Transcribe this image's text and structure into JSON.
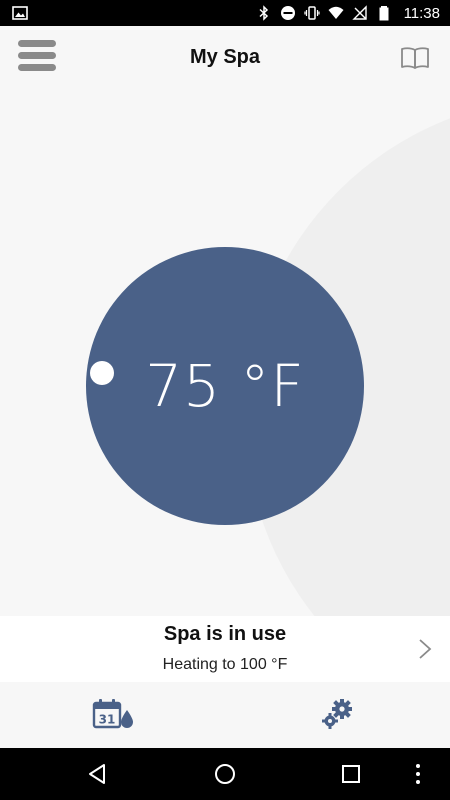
{
  "status_bar": {
    "time": "11:38",
    "icons": [
      "image-icon",
      "bluetooth-icon",
      "do-not-disturb-icon",
      "vibrate-icon",
      "wifi-icon",
      "no-sim-icon",
      "battery-icon"
    ]
  },
  "header": {
    "title": "My Spa",
    "menu_icon": "hamburger-menu-icon",
    "manual_icon": "book-icon"
  },
  "thermostat": {
    "temperature": "75 °F",
    "circle_color": "#4a6188",
    "knob_color": "#ffffff"
  },
  "status": {
    "title": "Spa is in use",
    "subtitle": "Heating to 100 °F"
  },
  "bottom_nav": {
    "calendar_day": "31",
    "icons": [
      "calendar-water-icon",
      "settings-gears-icon"
    ],
    "accent": "#4a6188"
  },
  "system_nav": {
    "icons": [
      "back-icon",
      "home-icon",
      "recents-icon",
      "more-icon"
    ]
  }
}
